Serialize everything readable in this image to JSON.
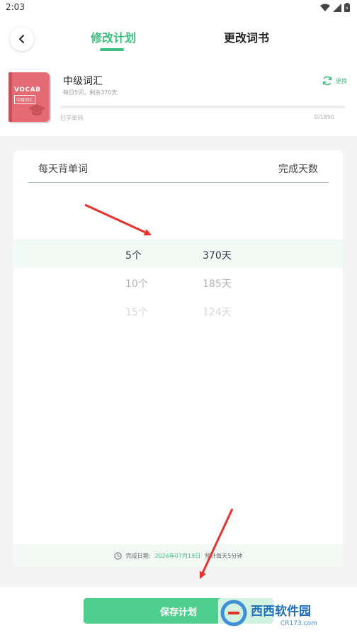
{
  "status_bar": {
    "time": "2:03"
  },
  "header": {
    "tabs": [
      {
        "label": "修改计划",
        "active": true
      },
      {
        "label": "更改词书",
        "active": false
      }
    ]
  },
  "book": {
    "name": "中级词汇",
    "meta": "每日5词，剩余370天",
    "cover_title": "VOCAB",
    "cover_subtitle": "中级词汇",
    "switch_label": "更换",
    "learned_label": "已学单词",
    "learned_count": "0/1850",
    "progress": 0
  },
  "plan": {
    "column_left": "每天背单词",
    "column_right": "完成天数",
    "rows": [
      {
        "count": "5个",
        "days": "370天",
        "selected": true
      },
      {
        "count": "10个",
        "days": "185天",
        "selected": false
      },
      {
        "count": "15个",
        "days": "124天",
        "selected": false
      }
    ],
    "footer": {
      "label": "完成日期:",
      "date": "2026年07月19日",
      "estimate": "预计每天5分钟"
    }
  },
  "save_label": "保存计划",
  "watermark": {
    "brand": "西西软件园",
    "domain": "CR173.com"
  },
  "colors": {
    "accent": "#3fbf7f",
    "button": "#4fcf8d",
    "cover": "#e46b73",
    "annotation_arrow": "#e8322c"
  }
}
